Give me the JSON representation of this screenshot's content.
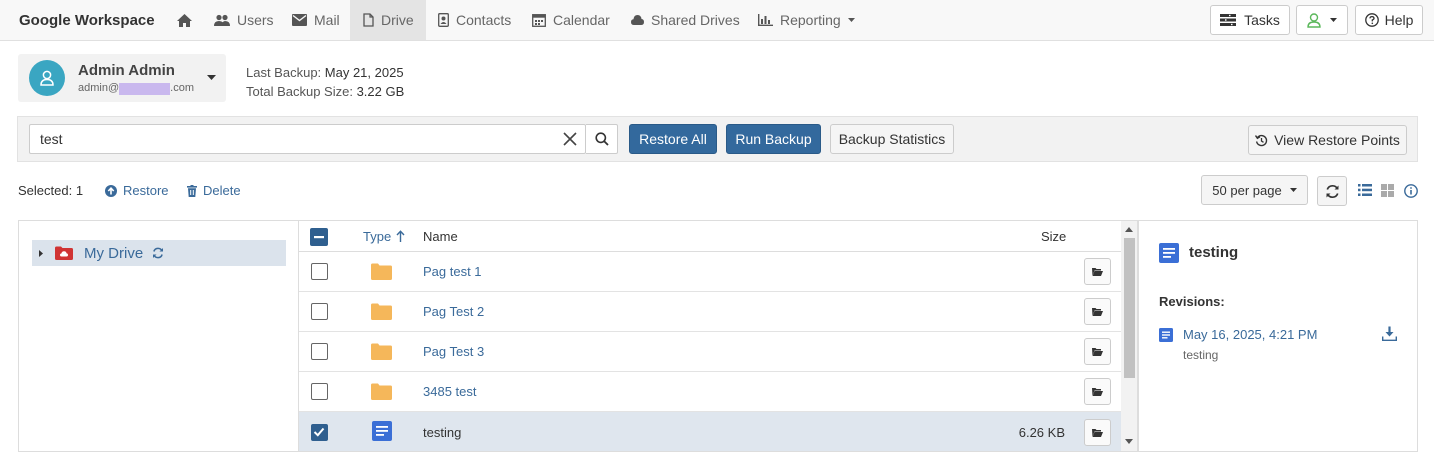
{
  "brand": "Google Workspace",
  "nav": {
    "users": "Users",
    "mail": "Mail",
    "drive": "Drive",
    "contacts": "Contacts",
    "calendar": "Calendar",
    "shared_drives": "Shared Drives",
    "reporting": "Reporting",
    "tasks": "Tasks",
    "help": "Help"
  },
  "account": {
    "name": "Admin Admin",
    "email_prefix": "admin@",
    "email_suffix": ".com"
  },
  "backup": {
    "last_label": "Last Backup:",
    "last_value": "May 21, 2025",
    "size_label": "Total Backup Size:",
    "size_value": "3.22 GB"
  },
  "search": {
    "value": "test"
  },
  "toolbar": {
    "restore_all": "Restore All",
    "run_backup": "Run Backup",
    "backup_statistics": "Backup Statistics",
    "view_restore_points": "View Restore Points"
  },
  "selection": {
    "label": "Selected: 1",
    "restore": "Restore",
    "delete": "Delete",
    "per_page": "50 per page"
  },
  "tree": {
    "root": "My Drive"
  },
  "grid": {
    "headers": {
      "type": "Type",
      "name": "Name",
      "size": "Size"
    },
    "rows": [
      {
        "name": "Pag test 1",
        "type": "folder",
        "size": "",
        "checked": false
      },
      {
        "name": "Pag Test 2",
        "type": "folder",
        "size": "",
        "checked": false
      },
      {
        "name": "Pag Test 3",
        "type": "folder",
        "size": "",
        "checked": false
      },
      {
        "name": "3485 test",
        "type": "folder",
        "size": "",
        "checked": false
      },
      {
        "name": "testing",
        "type": "doc",
        "size": "6.26 KB",
        "checked": true
      }
    ]
  },
  "detail": {
    "title": "testing",
    "revisions_label": "Revisions:",
    "revision": {
      "date": "May 16, 2025, 4:21 PM",
      "name": "testing"
    }
  },
  "colors": {
    "primary": "#33699d",
    "link": "#3a6a9a",
    "avatar": "#3aa6c2",
    "folder": "#f5b75a",
    "doc": "#3b6fd6"
  }
}
